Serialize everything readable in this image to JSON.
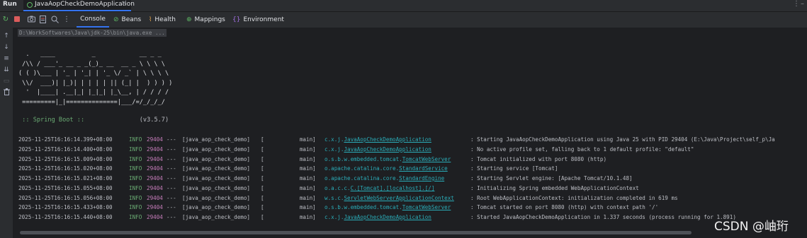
{
  "header": {
    "run_label": "Run",
    "tab_title": "JavaAopCheckDemoApplication",
    "tab_close": "×",
    "more": "⋮",
    "minimize": "–"
  },
  "toolbar": {
    "tabs": [
      "Console",
      "Beans",
      "Health",
      "Mappings",
      "Environment"
    ]
  },
  "console": {
    "command": "D:\\WorkSoftwares\\Java\\jdk-25\\bin\\java.exe ...",
    "banner": [
      "  .   ____          _            __ _ _",
      " /\\\\ / ___'_ __ _ _(_)_ __  __ _ \\ \\ \\ \\",
      "( ( )\\___ | '_ | '_| | '_ \\/ _` | \\ \\ \\ \\",
      " \\\\/  ___)| |_)| | | | | || (_| |  ) ) ) )",
      "  '  |____| .__|_| |_|_| |_\\__, | / / / /",
      " =========|_|==============|___/=/_/_/_/"
    ],
    "spring_label": " :: Spring Boot :: ",
    "spring_version": "              (v3.5.7)",
    "logs": [
      {
        "ts": "2025-11-25T16:16:14.399+08:00",
        "level": "INFO",
        "pid": "29404",
        "sep": "---",
        "app": "[java_aop_check_demo]",
        "thread": "[           main]",
        "logger_pre": "c.x.j.",
        "logger_link": "JavaAopCheckDemoApplication",
        "msg": ": Starting JavaAopCheckDemoApplication using Java 25 with PID 29404 (E:\\Java\\Project\\self_p\\Ja"
      },
      {
        "ts": "2025-11-25T16:16:14.400+08:00",
        "level": "INFO",
        "pid": "29404",
        "sep": "---",
        "app": "[java_aop_check_demo]",
        "thread": "[           main]",
        "logger_pre": "c.x.j.",
        "logger_link": "JavaAopCheckDemoApplication",
        "msg": ": No active profile set, falling back to 1 default profile: \"default\""
      },
      {
        "ts": "2025-11-25T16:16:15.009+08:00",
        "level": "INFO",
        "pid": "29404",
        "sep": "---",
        "app": "[java_aop_check_demo]",
        "thread": "[           main]",
        "logger_pre": "o.s.b.w.embedded.tomcat.",
        "logger_link": "TomcatWebServer",
        "msg": ": Tomcat initialized with port 8080 (http)"
      },
      {
        "ts": "2025-11-25T16:16:15.020+08:00",
        "level": "INFO",
        "pid": "29404",
        "sep": "---",
        "app": "[java_aop_check_demo]",
        "thread": "[           main]",
        "logger_pre": "o.apache.catalina.core.",
        "logger_link": "StandardService",
        "msg": ": Starting service [Tomcat]"
      },
      {
        "ts": "2025-11-25T16:16:15.021+08:00",
        "level": "INFO",
        "pid": "29404",
        "sep": "---",
        "app": "[java_aop_check_demo]",
        "thread": "[           main]",
        "logger_pre": "o.apache.catalina.core.",
        "logger_link": "StandardEngine",
        "msg": ": Starting Servlet engine: [Apache Tomcat/10.1.48]"
      },
      {
        "ts": "2025-11-25T16:16:15.055+08:00",
        "level": "INFO",
        "pid": "29404",
        "sep": "---",
        "app": "[java_aop_check_demo]",
        "thread": "[           main]",
        "logger_pre": "o.a.c.c.",
        "logger_link": "C.[Tomcat].[localhost].[/]",
        "msg": ": Initializing Spring embedded WebApplicationContext"
      },
      {
        "ts": "2025-11-25T16:16:15.056+08:00",
        "level": "INFO",
        "pid": "29404",
        "sep": "---",
        "app": "[java_aop_check_demo]",
        "thread": "[           main]",
        "logger_pre": "w.s.c.",
        "logger_link": "ServletWebServerApplicationContext",
        "msg": ": Root WebApplicationContext: initialization completed in 619 ms"
      },
      {
        "ts": "2025-11-25T16:16:15.433+08:00",
        "level": "INFO",
        "pid": "29404",
        "sep": "---",
        "app": "[java_aop_check_demo]",
        "thread": "[           main]",
        "logger_pre": "o.s.b.w.embedded.tomcat.",
        "logger_link": "TomcatWebServer",
        "msg": ": Tomcat started on port 8080 (http) with context path '/'"
      },
      {
        "ts": "2025-11-25T16:16:15.440+08:00",
        "level": "INFO",
        "pid": "29404",
        "sep": "---",
        "app": "[java_aop_check_demo]",
        "thread": "[           main]",
        "logger_pre": "c.x.j.",
        "logger_link": "JavaAopCheckDemoApplication",
        "msg": ": Started JavaAopCheckDemoApplication in 1.337 seconds (process running for 1.891)"
      }
    ]
  },
  "watermark": "CSDN @岫珩"
}
